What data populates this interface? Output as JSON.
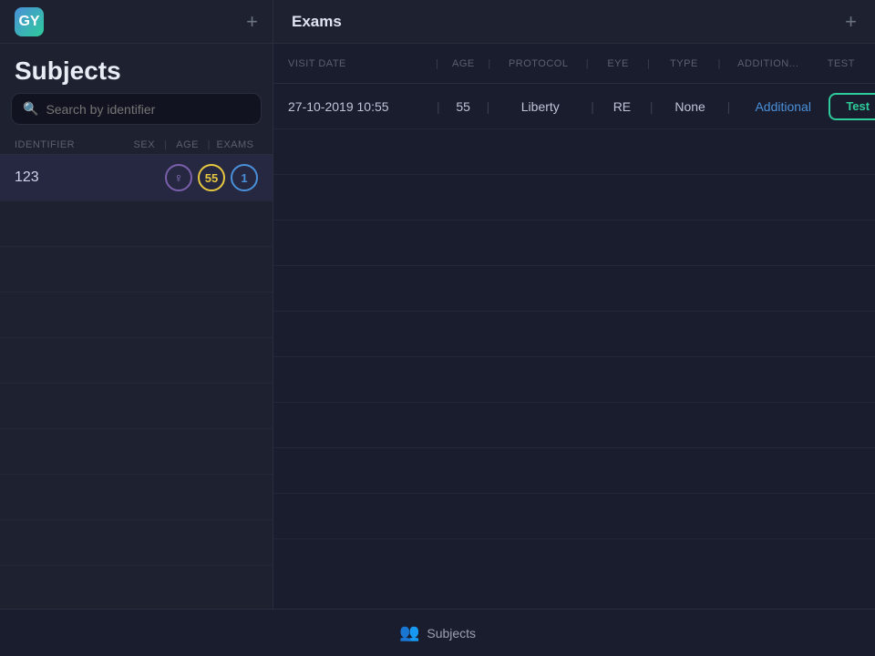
{
  "app": {
    "icon_label": "GY",
    "left_add_label": "+",
    "right_add_label": "+"
  },
  "left_panel": {
    "heading": "Subjects",
    "search_placeholder": "Search by identifier",
    "table_header": {
      "identifier": "IDENTIFIER",
      "sex": "SEX",
      "age": "AGE",
      "exams": "EXAMS"
    },
    "subjects": [
      {
        "id": "123",
        "sex_icon": "⊙",
        "age": "55",
        "exams": "1"
      }
    ]
  },
  "right_panel": {
    "title": "Exams",
    "table_header": {
      "visit_date": "VISIT DATE",
      "age": "AGE",
      "protocol": "PROTOCOL",
      "eye": "EYE",
      "type": "TYPE",
      "additional": "ADDITION...",
      "test": "TEST"
    },
    "exams": [
      {
        "visit_date": "27-10-2019 10:55",
        "age": "55",
        "protocol": "Liberty",
        "eye": "RE",
        "type": "None",
        "additional": "Additional",
        "test_label": "Test"
      }
    ]
  },
  "bottom_bar": {
    "icon": "👥",
    "label": "Subjects"
  }
}
